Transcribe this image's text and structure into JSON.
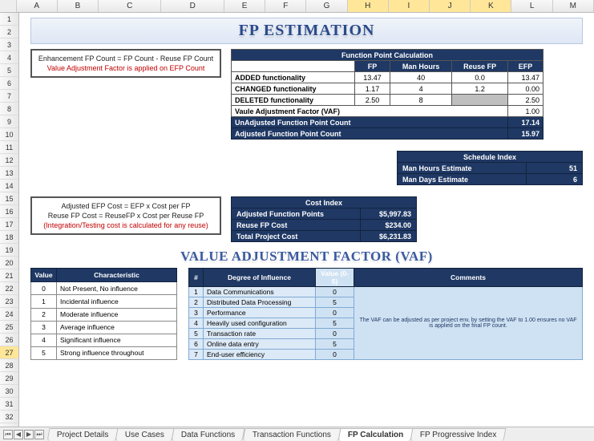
{
  "cols": [
    "A",
    "B",
    "C",
    "D",
    "E",
    "F",
    "G",
    "H",
    "I",
    "J",
    "K",
    "L",
    "M"
  ],
  "rows_from": 1,
  "rows_to": 33,
  "title1": "FP ESTIMATION",
  "title2": "VALUE ADJUSTMENT FACTOR (VAF)",
  "note1_line1": "Enhancement FP Count =  FP Count - Reuse FP Count",
  "note1_line2": "Value Adjustment Factor is applied on EFP Count",
  "note2_line1": "Adjusted EFP Cost = EFP x Cost per FP",
  "note2_line2": "Reuse FP Cost = ReuseFP x Cost per Reuse FP",
  "note2_line3": "(Integration/Testing cost is calculated for any reuse)",
  "fp": {
    "header": "Function Point Calculation",
    "cols": [
      "",
      "FP",
      "Man Hours",
      "Reuse FP",
      "EFP"
    ],
    "rows": [
      {
        "label": "ADDED functionality",
        "fp": "13.47",
        "mh": "40",
        "reuse": "0.0",
        "efp": "13.47"
      },
      {
        "label": "CHANGED functionality",
        "fp": "1.17",
        "mh": "4",
        "reuse": "1.2",
        "efp": "0.00"
      },
      {
        "label": "DELETED functionality",
        "fp": "2.50",
        "mh": "8",
        "reuse": "",
        "efp": "2.50",
        "gray": true
      }
    ],
    "vaf_label": "Vaule Adjustment Factor (VAF)",
    "vaf_val": "1.00",
    "unadj_label": "UnAdjusted Function Point Count",
    "unadj_val": "17.14",
    "adj_label": "Adjusted Function Point Count",
    "adj_val": "15.97"
  },
  "sched": {
    "header": "Schedule Index",
    "rows": [
      {
        "label": "Man Hours Estimate",
        "val": "51"
      },
      {
        "label": "Man Days Estimate",
        "val": "6"
      }
    ]
  },
  "cost": {
    "header": "Cost Index",
    "rows": [
      {
        "label": "Adjusted Function Points",
        "val": "$5,997.83"
      },
      {
        "label": "Reuse FP Cost",
        "val": "$234.00"
      },
      {
        "label": "Total Project Cost",
        "val": "$6,231.83"
      }
    ]
  },
  "vaf_left": {
    "h1": "Value",
    "h2": "Characteristic",
    "rows": [
      {
        "v": "0",
        "c": "Not Present, No influence"
      },
      {
        "v": "1",
        "c": "Incidental influence"
      },
      {
        "v": "2",
        "c": "Moderate influence"
      },
      {
        "v": "3",
        "c": "Average influence"
      },
      {
        "v": "4",
        "c": "Significant influence"
      },
      {
        "v": "5",
        "c": "Strong influence throughout"
      }
    ]
  },
  "vaf_right": {
    "h1": "#",
    "h2": "Degree of Influence",
    "h3": "Value (0-5)",
    "h4": "Comments",
    "comment": "The VAF can be adjusted as per project env, by setting the VAF to 1.00 ensures no VAF is applied on the final FP count.",
    "rows": [
      {
        "n": "1",
        "d": "Data Communications",
        "v": "0"
      },
      {
        "n": "2",
        "d": "Distributed Data Processing",
        "v": "5"
      },
      {
        "n": "3",
        "d": "Performance",
        "v": "0"
      },
      {
        "n": "4",
        "d": "Heavily used configuration",
        "v": "5"
      },
      {
        "n": "5",
        "d": "Transaction rate",
        "v": "0"
      },
      {
        "n": "6",
        "d": "Online data entry",
        "v": "5"
      },
      {
        "n": "7",
        "d": "End-user efficiency",
        "v": "0"
      }
    ]
  },
  "tabs": [
    "Project Details",
    "Use Cases",
    "Data Functions",
    "Transaction Functions",
    "FP Calculation",
    "FP Progressive Index"
  ],
  "active_tab": "FP Calculation"
}
